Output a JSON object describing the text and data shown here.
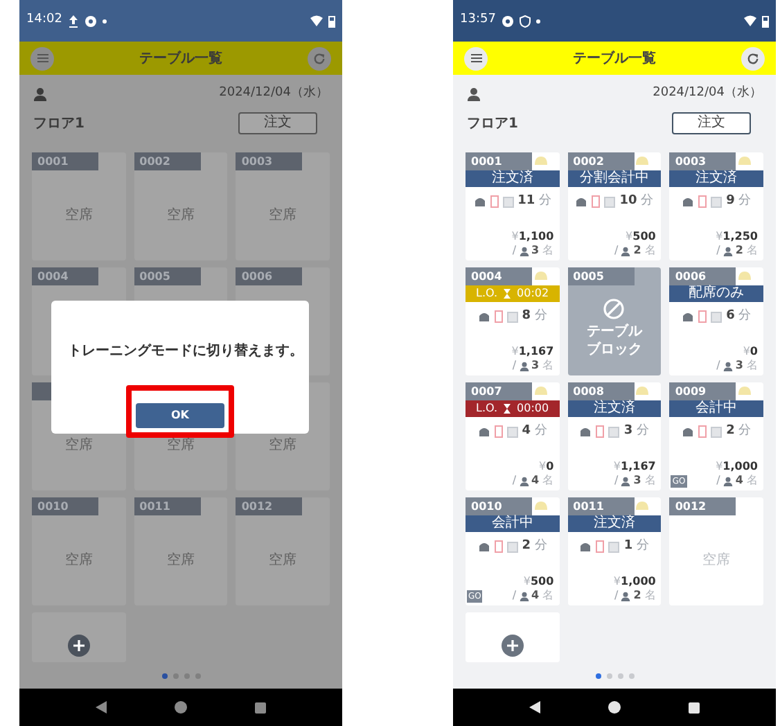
{
  "screens": [
    {
      "kind": "dimmed",
      "status_bar": {
        "time": "14:02"
      },
      "header": {
        "title": "テーブル一覧"
      },
      "date": "2024/12/04（水）",
      "floor": "フロア1",
      "order_button": "注文",
      "tables": [
        {
          "kind": "empty",
          "number": "0001",
          "status": "空席"
        },
        {
          "kind": "empty",
          "number": "0002",
          "status": "空席"
        },
        {
          "kind": "empty",
          "number": "0003",
          "status": "空席"
        },
        {
          "kind": "empty",
          "number": "0004"
        },
        {
          "kind": "empty",
          "number": "0005"
        },
        {
          "kind": "empty",
          "number": "0006"
        },
        {
          "kind": "empty",
          "tag": true,
          "status": "空席"
        },
        {
          "kind": "empty",
          "status": "空席"
        },
        {
          "kind": "empty",
          "status": "空席"
        },
        {
          "kind": "empty",
          "number": "0010",
          "status": "空席"
        },
        {
          "kind": "empty",
          "number": "0011",
          "status": "空席"
        },
        {
          "kind": "empty",
          "number": "0012",
          "status": "空席"
        }
      ],
      "page_dots": [
        {
          "selected": true
        },
        {
          "selected": false
        },
        {
          "selected": false
        },
        {
          "selected": false
        }
      ],
      "dialog": {
        "message": "トレーニングモードに切り替えます。",
        "button": "OK",
        "highlighted": true
      }
    },
    {
      "kind": "normal",
      "status_bar": {
        "time": "13:57"
      },
      "header": {
        "title": "テーブル一覧"
      },
      "date": "2024/12/04（水）",
      "floor": "フロア1",
      "order_button": "注文",
      "tables": [
        {
          "kind": "order",
          "number": "0001",
          "color": "#3c5c8a",
          "status": "注文済",
          "minutes": "**11** 分",
          "price": "¥**1,100**",
          "slash": "/",
          "guests": "**3** 名"
        },
        {
          "kind": "order",
          "number": "0002",
          "color": "#3c5c8a",
          "status": "分割会計中",
          "minutes": "**10** 分",
          "price": "¥**500**",
          "slash": "/",
          "guests": "**2** 名"
        },
        {
          "kind": "order",
          "number": "0003",
          "color": "#3c5c8a",
          "status": "注文済",
          "minutes": "**9** 分",
          "price": "¥**1,250**",
          "slash": "/",
          "guests": "**2** 名"
        },
        {
          "kind": "lastorder",
          "number": "0004",
          "color": "#d8b400",
          "status": "L.O.",
          "timer": "00:02",
          "minutes": "**8** 分",
          "price": "¥**1,167**",
          "slash": "/",
          "guests": "**3** 名"
        },
        {
          "kind": "blocked",
          "number": "0005",
          "lines": [
            "テーブル",
            "ブロック"
          ]
        },
        {
          "kind": "order",
          "number": "0006",
          "color": "#3c5c8a",
          "status": "配席のみ",
          "minutes": "**6** 分",
          "price": "¥**0**",
          "slash": "/",
          "guests": "**3** 名"
        },
        {
          "kind": "lastorder",
          "number": "0007",
          "color": "#a3262b",
          "status": "L.O.",
          "timer": "00:00",
          "minutes": "**4** 分",
          "price": "¥**0**",
          "slash": "/",
          "guests": "**4** 名"
        },
        {
          "kind": "order",
          "number": "0008",
          "color": "#3c5c8a",
          "status": "注文済",
          "minutes": "**3** 分",
          "price": "¥**1,167**",
          "slash": "/",
          "guests": "**3** 名"
        },
        {
          "kind": "order",
          "number": "0009",
          "color": "#3c5c8a",
          "status": "会計中",
          "minutes": "**2** 分",
          "price": "¥**1,000**",
          "slash": "/",
          "guests": "**4** 名",
          "badge": "GO"
        },
        {
          "kind": "order",
          "number": "0010",
          "color": "#3c5c8a",
          "status": "会計中",
          "minutes": "**2** 分",
          "price": "¥**500**",
          "slash": "/",
          "guests": "**4** 名",
          "badge": "GO"
        },
        {
          "kind": "order",
          "number": "0011",
          "color": "#3c5c8a",
          "status": "注文済",
          "minutes": "**1** 分",
          "price": "¥**1,000**",
          "slash": "/",
          "guests": "**2** 名"
        },
        {
          "kind": "empty",
          "number": "0012",
          "status": "空席"
        }
      ],
      "page_dots": [
        {
          "selected": true
        },
        {
          "selected": false
        },
        {
          "selected": false
        },
        {
          "selected": false
        }
      ]
    }
  ]
}
